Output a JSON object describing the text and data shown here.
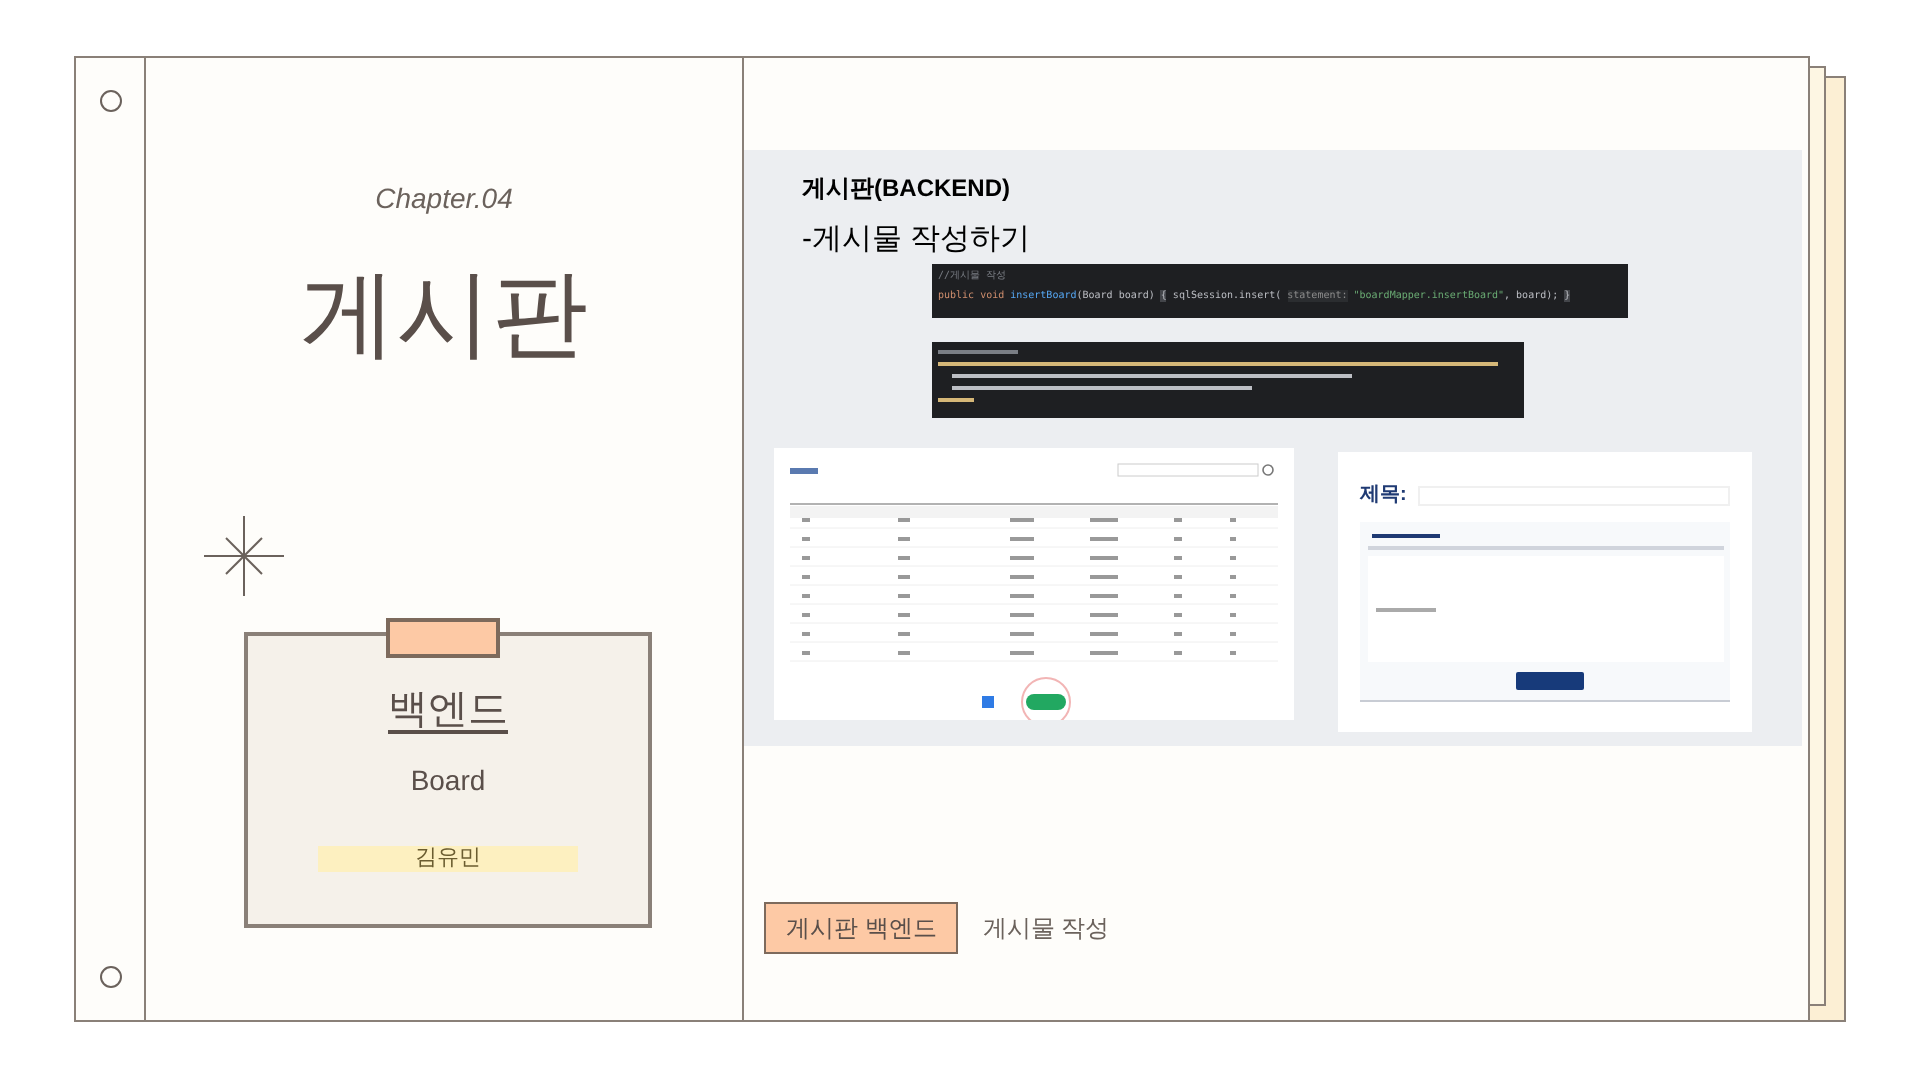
{
  "left_page": {
    "chapter_label": "Chapter.04",
    "title": "게시판",
    "card": {
      "heading": "백엔드",
      "subtitle": "Board",
      "author": "김유민"
    }
  },
  "content": {
    "heading": "게시판(BACKEND)",
    "subheading": "-게시물 작성하기",
    "code_snippet": {
      "comment": "//게시물 작성",
      "tokens": [
        {
          "kind": "keyword",
          "text": "public void "
        },
        {
          "kind": "method",
          "text": "insertBoard"
        },
        {
          "kind": "plain",
          "text": "(Board board) "
        },
        {
          "kind": "bracket",
          "text": "{"
        },
        {
          "kind": "plain",
          "text": " sqlSession.insert( "
        },
        {
          "kind": "hint",
          "text": "statement:"
        },
        {
          "kind": "string",
          "text": " \"boardMapper.insertBoard\""
        },
        {
          "kind": "plain",
          "text": ", board); "
        },
        {
          "kind": "bracket",
          "text": "}"
        }
      ]
    },
    "form_screenshot": {
      "title_label": "제목:"
    }
  },
  "footer_tags": [
    {
      "label": "게시판 백엔드",
      "highlighted": true
    },
    {
      "label": "게시물 작성",
      "highlighted": false
    }
  ]
}
